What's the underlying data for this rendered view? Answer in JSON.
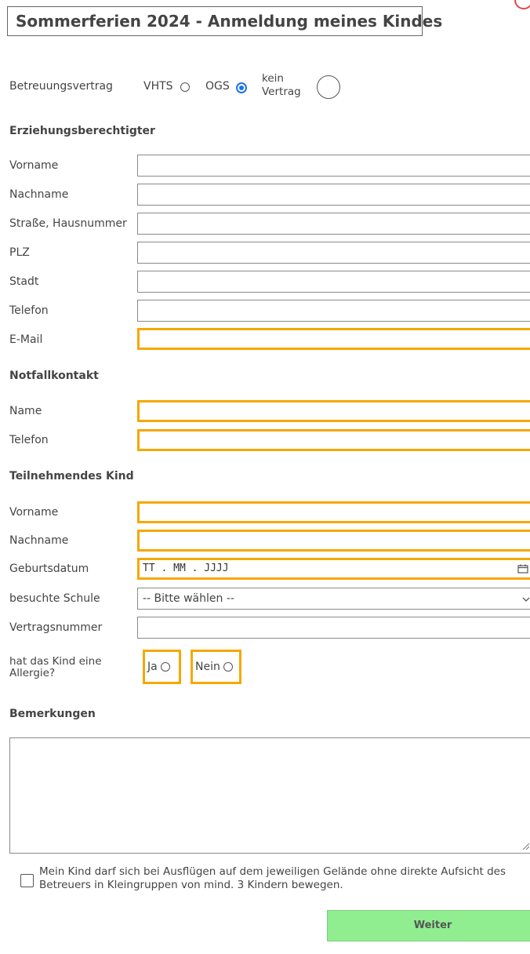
{
  "header": {
    "title": "Sommerferien 2024 - Anmeldung meines Kindes"
  },
  "contract": {
    "label": "Betreuungsvertrag",
    "options": [
      {
        "label": "VHTS",
        "selected": false
      },
      {
        "label": "OGS",
        "selected": true
      },
      {
        "label_line1": "kein",
        "label_line2": "Vertrag",
        "selected": false
      }
    ]
  },
  "guardian": {
    "heading": "Erziehungsberechtigter",
    "fields": {
      "vorname": "Vorname",
      "nachname": "Nachname",
      "strasse": "Straße, Hausnummer",
      "plz": "PLZ",
      "stadt": "Stadt",
      "telefon": "Telefon",
      "email": "E-Mail"
    }
  },
  "emergency": {
    "heading": "Notfallkontakt",
    "fields": {
      "name": "Name",
      "telefon": "Telefon"
    }
  },
  "child": {
    "heading": "Teilnehmendes Kind",
    "fields": {
      "vorname": "Vorname",
      "nachname": "Nachname",
      "geburtsdatum": "Geburtsdatum",
      "schule": "besuchte Schule",
      "vertragsnummer": "Vertragsnummer"
    },
    "date_placeholder": "TT . MM . JJJJ",
    "school_selected": "-- Bitte wählen --",
    "allergy": {
      "label_line1": "hat das Kind eine",
      "label_line2": "Allergie?",
      "yes": "Ja",
      "no": "Nein"
    }
  },
  "remarks": {
    "heading": "Bemerkungen"
  },
  "consent": {
    "text": "Mein Kind darf sich bei Ausflügen auf dem jeweiligen Gelände ohne direkte Aufsicht des Betreuers in Kleingruppen von mind. 3 Kindern bewegen."
  },
  "actions": {
    "next": "Weiter"
  },
  "colors": {
    "highlight": "#f5a800",
    "button": "#90ee90",
    "radio_selected": "#1a73e8"
  }
}
